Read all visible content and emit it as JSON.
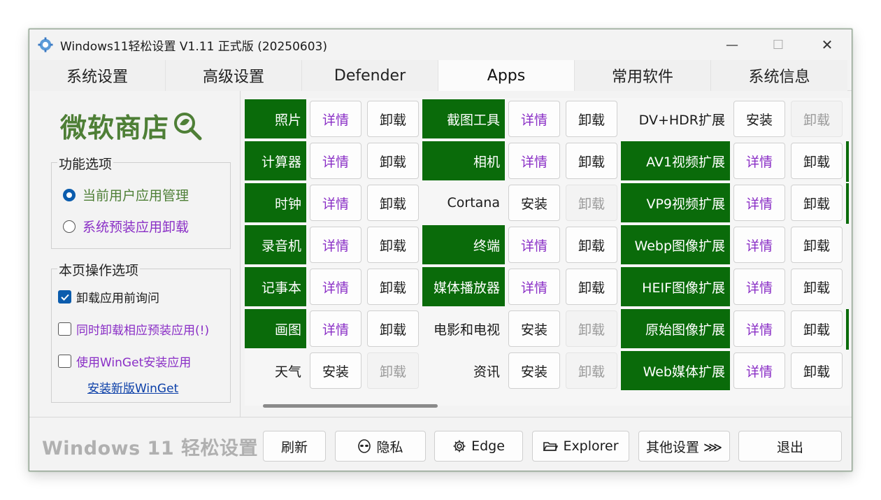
{
  "window": {
    "title": "Windows11轻松设置 V1.11 正式版 (20250603)",
    "controls": {
      "minimize": "—",
      "maximize": "☐",
      "close": "✕"
    }
  },
  "tabs": [
    {
      "label": "系统设置"
    },
    {
      "label": "高级设置"
    },
    {
      "label": "Defender"
    },
    {
      "label": "Apps",
      "active": true
    },
    {
      "label": "常用软件"
    },
    {
      "label": "系统信息"
    }
  ],
  "left": {
    "store_title": "微软商店",
    "options_group": {
      "label": "功能选项",
      "radio_current_user": "当前用户应用管理",
      "radio_preinstalled": "系统预装应用卸载"
    },
    "page_options_group": {
      "label": "本页操作选项",
      "ask_before_uninstall": "卸载应用前询问",
      "uninstall_preinstalled": "同时卸载相应预装应用(!)",
      "use_winget": "使用WinGet安装应用",
      "install_winget_link": "安装新版WinGet"
    }
  },
  "buttons": {
    "detail": "详情",
    "uninstall": "卸载",
    "install": "安装"
  },
  "apps": {
    "col1": [
      {
        "name": "照片",
        "installed": true
      },
      {
        "name": "计算器",
        "installed": true
      },
      {
        "name": "时钟",
        "installed": true
      },
      {
        "name": "录音机",
        "installed": true
      },
      {
        "name": "记事本",
        "installed": true
      },
      {
        "name": "画图",
        "installed": true
      },
      {
        "name": "天气",
        "installed": false
      }
    ],
    "col2": [
      {
        "name": "截图工具",
        "installed": true
      },
      {
        "name": "相机",
        "installed": true
      },
      {
        "name": "Cortana",
        "installed": false
      },
      {
        "name": "终端",
        "installed": true
      },
      {
        "name": "媒体播放器",
        "installed": true
      },
      {
        "name": "电影和电视",
        "installed": false
      },
      {
        "name": "资讯",
        "installed": false
      }
    ],
    "col3": [
      {
        "name": "DV+HDR扩展",
        "installed": false
      },
      {
        "name": "AV1视频扩展",
        "installed": true
      },
      {
        "name": "VP9视频扩展",
        "installed": true
      },
      {
        "name": "Webp图像扩展",
        "installed": true
      },
      {
        "name": "HEIF图像扩展",
        "installed": true
      },
      {
        "name": "原始图像扩展",
        "installed": true
      },
      {
        "name": "Web媒体扩展",
        "installed": true
      }
    ]
  },
  "bottom": {
    "brand": "Windows 11 轻松设置",
    "refresh": "刷新",
    "privacy": "隐私",
    "edge": "Edge",
    "explorer": "Explorer",
    "other_settings": "其他设置 ⋙",
    "exit": "退出"
  },
  "colors": {
    "installed_bg": "#0a6b0a",
    "store_title": "#4e7f36",
    "detail_text": "#8a2fc6",
    "accent": "#0b5cad"
  }
}
